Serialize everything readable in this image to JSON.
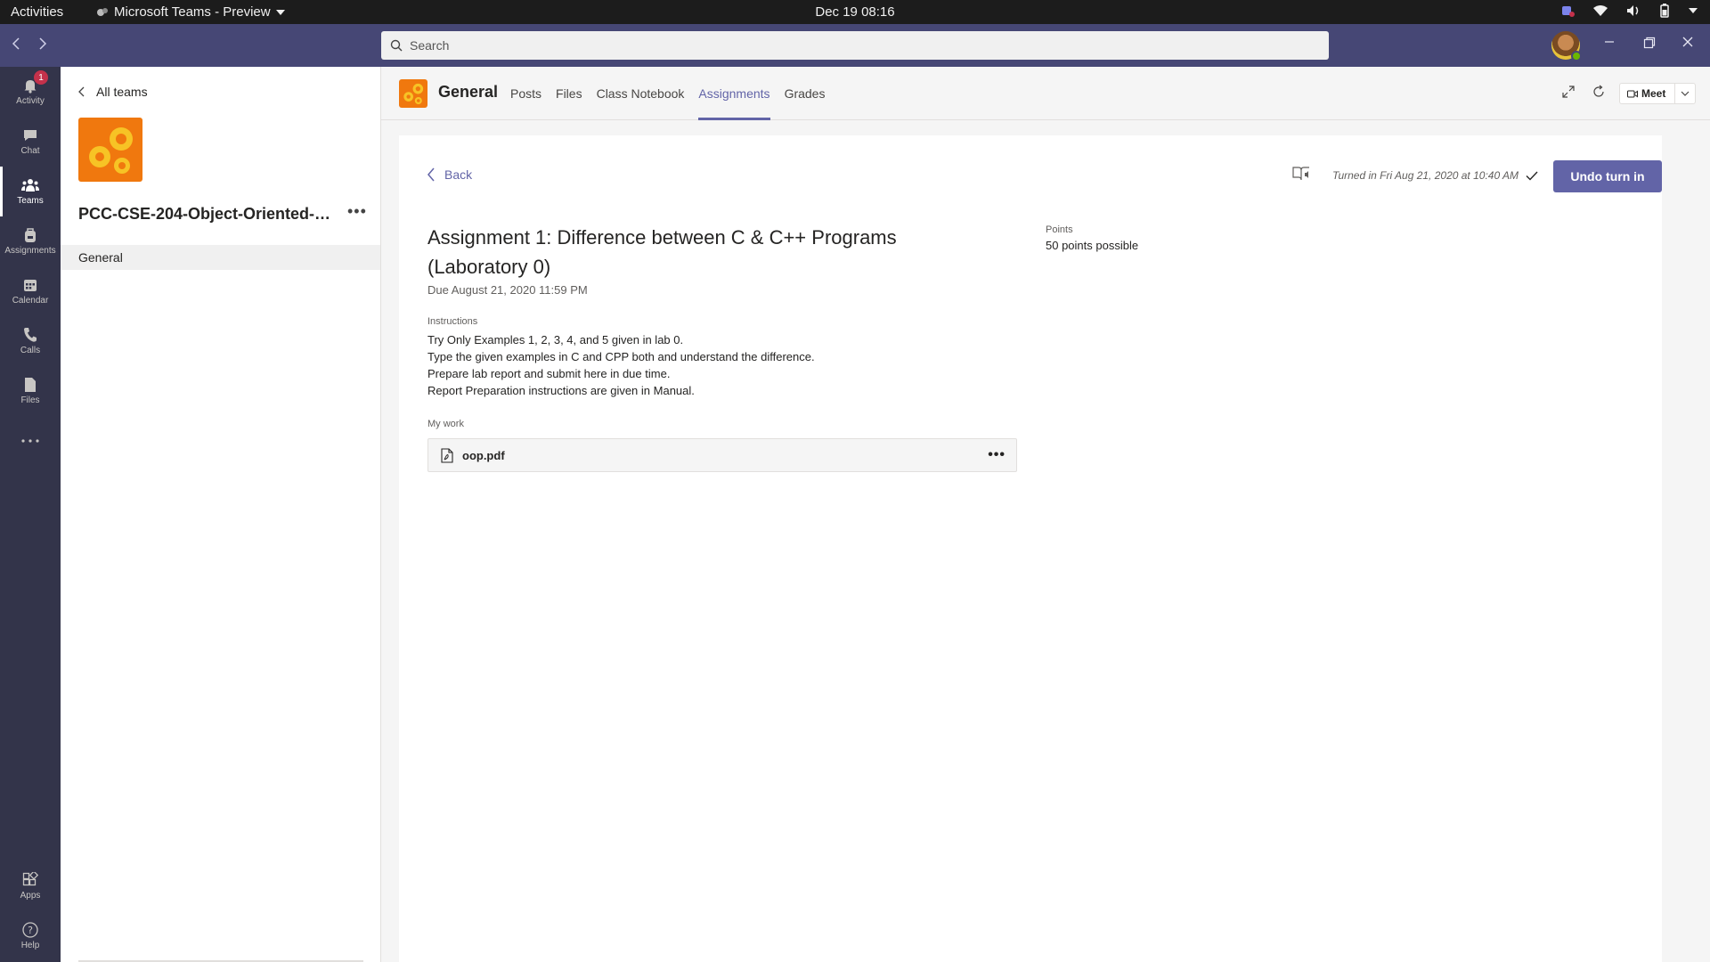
{
  "system_bar": {
    "activities": "Activities",
    "app_menu": "Microsoft Teams - Preview",
    "datetime": "Dec 19  08:16"
  },
  "search": {
    "placeholder": "Search"
  },
  "rail": {
    "items": [
      {
        "label": "Activity",
        "badge": "1"
      },
      {
        "label": "Chat"
      },
      {
        "label": "Teams"
      },
      {
        "label": "Assignments"
      },
      {
        "label": "Calendar"
      },
      {
        "label": "Calls"
      },
      {
        "label": "Files"
      },
      {
        "label": "Apps"
      },
      {
        "label": "Help"
      }
    ]
  },
  "team_panel": {
    "back_label": "All teams",
    "team_name": "PCC-CSE-204-Object-Oriented-Pr...",
    "channels": [
      "General"
    ]
  },
  "channel_header": {
    "name": "General",
    "tabs": [
      "Posts",
      "Files",
      "Class Notebook",
      "Assignments",
      "Grades"
    ],
    "active_tab": "Assignments",
    "meet_label": "Meet"
  },
  "assignment": {
    "back_label": "Back",
    "turned_in_text": "Turned in Fri Aug 21, 2020 at 10:40 AM",
    "undo_label": "Undo turn in",
    "title": "Assignment 1: Difference between C & C++ Programs (Laboratory 0)",
    "due": "Due August 21, 2020 11:59 PM",
    "points_label": "Points",
    "points_value": "50 points possible",
    "instructions_label": "Instructions",
    "instructions": [
      "Try Only Examples 1, 2, 3, 4, and 5 given in lab 0.",
      "Type the given examples in C and CPP both and understand the difference.",
      "Prepare lab report and submit here in due time.",
      "Report Preparation instructions are given in Manual."
    ],
    "my_work_label": "My work",
    "files": [
      {
        "name": "oop.pdf"
      }
    ]
  },
  "colors": {
    "titlebar": "#464775",
    "rail": "#33344a",
    "accent": "#6264a7",
    "team_logo": "#f0780e"
  }
}
